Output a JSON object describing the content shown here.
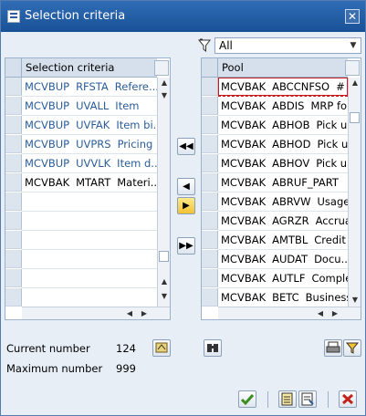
{
  "window": {
    "title": "Selection criteria"
  },
  "filter": {
    "value": "All"
  },
  "left_table": {
    "header": "Selection criteria",
    "rows": [
      {
        "table": "MCVBUP",
        "field": "RFSTA",
        "desc": "Refere..."
      },
      {
        "table": "MCVBUP",
        "field": "UVALL",
        "desc": "Item"
      },
      {
        "table": "MCVBUP",
        "field": "UVFAK",
        "desc": "Item bi..."
      },
      {
        "table": "MCVBUP",
        "field": "UVPRS",
        "desc": "Pricing"
      },
      {
        "table": "MCVBUP",
        "field": "UVVLK",
        "desc": "Item d..."
      },
      {
        "table": "MCVBAK",
        "field": "MTART",
        "desc": "Materi..."
      }
    ]
  },
  "right_table": {
    "header": "Pool",
    "rows": [
      {
        "table": "MCVBAK",
        "field": "ABCCNFSO",
        "desc": "#"
      },
      {
        "table": "MCVBAK",
        "field": "ABDIS",
        "desc": "MRP fo"
      },
      {
        "table": "MCVBAK",
        "field": "ABHOB",
        "desc": "Pick u"
      },
      {
        "table": "MCVBAK",
        "field": "ABHOD",
        "desc": "Pick u"
      },
      {
        "table": "MCVBAK",
        "field": "ABHOV",
        "desc": "Pick u"
      },
      {
        "table": "MCVBAK",
        "field": "ABRUF_PART",
        "desc": ""
      },
      {
        "table": "MCVBAK",
        "field": "ABRVW",
        "desc": "Usage"
      },
      {
        "table": "MCVBAK",
        "field": "AGRZR",
        "desc": "Accrua"
      },
      {
        "table": "MCVBAK",
        "field": "AMTBL",
        "desc": "Credit"
      },
      {
        "table": "MCVBAK",
        "field": "AUDAT",
        "desc": "Docu..."
      },
      {
        "table": "MCVBAK",
        "field": "AUTLF",
        "desc": "Comple"
      },
      {
        "table": "MCVBAK",
        "field": "BETC",
        "desc": "Business"
      }
    ]
  },
  "counts": {
    "current_label": "Current number",
    "current_value": "124",
    "max_label": "Maximum number",
    "max_value": "999"
  },
  "colors": {
    "selected_text": "#2b5d99",
    "titlebar": "#195197"
  }
}
